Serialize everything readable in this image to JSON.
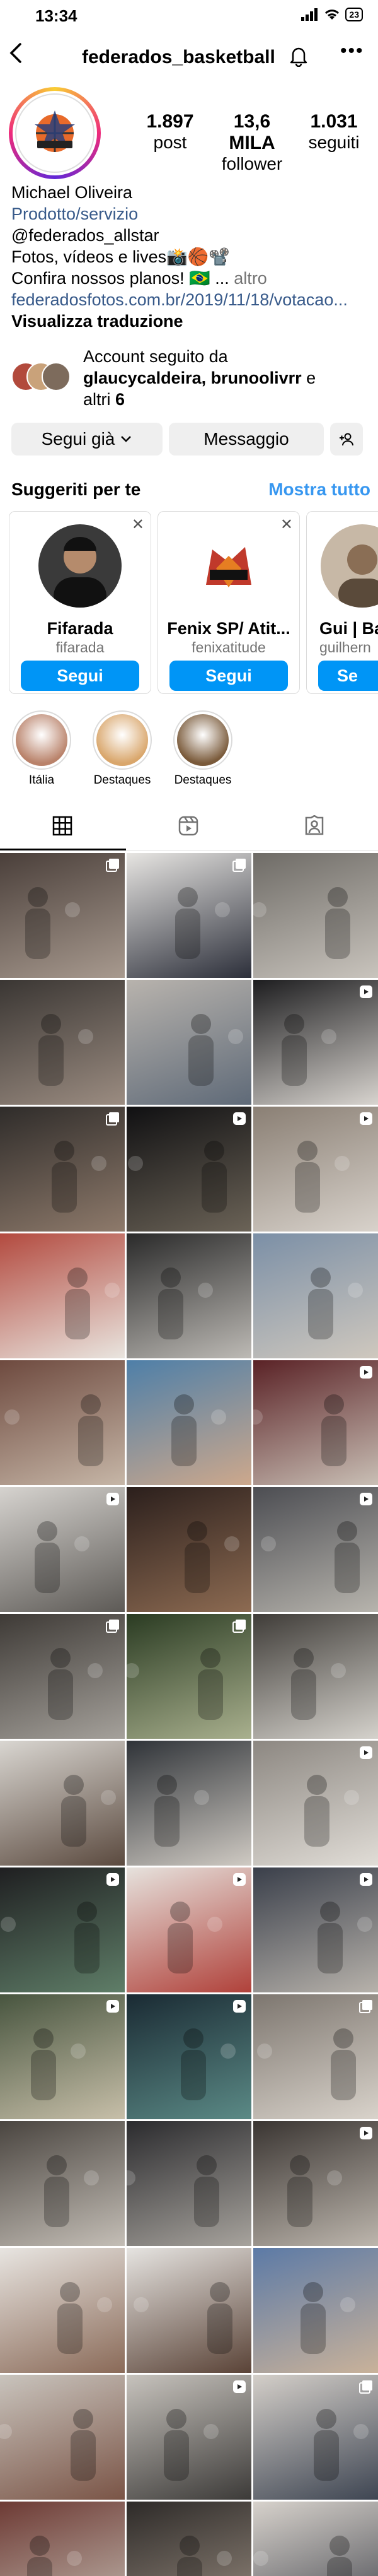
{
  "status_bar": {
    "time": "13:34",
    "battery": "23"
  },
  "header": {
    "username": "federados_basketball"
  },
  "profile": {
    "stats": [
      {
        "value": "1.897",
        "label": "post"
      },
      {
        "value": "13,6 MILA",
        "label": "follower"
      },
      {
        "value": "1.031",
        "label": "seguiti"
      }
    ],
    "bio": {
      "name": "Michael Oliveira",
      "category": "Prodotto/servizio",
      "handle_line": "@federados_allstar",
      "line1": "Fotos, vídeos e lives📸🏀📽️",
      "line2_text": "Confira nossos planos! 🇧🇷 ...",
      "line2_more": "altro",
      "link": "federadosfotos.com.br/2019/11/18/votacao...",
      "translate": "Visualizza traduzione"
    },
    "followed_by": {
      "prefix": "Account seguito da",
      "names": "glaucycaldeira, brunoolivrr",
      "suffix_and": "e",
      "suffix_others": "altri",
      "count": "6"
    },
    "actions": {
      "following": "Segui già",
      "message": "Messaggio"
    }
  },
  "suggestions": {
    "title": "Suggeriti per te",
    "see_all": "Mostra tutto",
    "cards": [
      {
        "name": "Fifarada",
        "handle": "fifarada",
        "follow": "Segui",
        "avatar_color": "#222222"
      },
      {
        "name": "Fenix SP/ Atit...",
        "handle": "fenixatitude",
        "follow": "Segui",
        "avatar_color": "#c0392b"
      },
      {
        "name": "Gui | Ba",
        "handle": "guilhern",
        "follow": "Se",
        "avatar_color": "#8a6e55"
      }
    ]
  },
  "highlights": [
    {
      "label": "Itália",
      "color": "#b9826a"
    },
    {
      "label": "Destaques",
      "color": "#d9a66b"
    },
    {
      "label": "Destaques",
      "color": "#7a5a3a"
    }
  ],
  "grid": {
    "tiles": [
      {
        "c1": "#4a3f3a",
        "c2": "#a89a8f",
        "badge": "multi"
      },
      {
        "c1": "#e7e5e2",
        "c2": "#2c2f3a",
        "badge": "multi"
      },
      {
        "c1": "#6e6b66",
        "c2": "#c9c4bd",
        "badge": "none"
      },
      {
        "c1": "#3a3633",
        "c2": "#9b8c81",
        "badge": "none"
      },
      {
        "c1": "#b8b3ad",
        "c2": "#5f6a78",
        "badge": "none"
      },
      {
        "c1": "#1d1d1f",
        "c2": "#d8d4cf",
        "badge": "reel"
      },
      {
        "c1": "#2f2c2a",
        "c2": "#8e7a6b",
        "badge": "multi"
      },
      {
        "c1": "#101012",
        "c2": "#6b6357",
        "badge": "reel"
      },
      {
        "c1": "#8a7f74",
        "c2": "#d8d2cb",
        "badge": "reel"
      },
      {
        "c1": "#b34a3f",
        "c2": "#e9e5df",
        "badge": "none"
      },
      {
        "c1": "#2a2a2a",
        "c2": "#bdbab5",
        "badge": "none"
      },
      {
        "c1": "#7b8fa6",
        "c2": "#cfc8be",
        "badge": "none"
      },
      {
        "c1": "#6e4a3f",
        "c2": "#c6b6a7",
        "badge": "none"
      },
      {
        "c1": "#4e7fa8",
        "c2": "#cda88c",
        "badge": "none"
      },
      {
        "c1": "#5a2226",
        "c2": "#c9bfb5",
        "badge": "reel"
      },
      {
        "c1": "#d6d3cf",
        "c2": "#5d5a56",
        "badge": "reel"
      },
      {
        "c1": "#2b1f1c",
        "c2": "#8d6b52",
        "badge": "none"
      },
      {
        "c1": "#4c4d52",
        "c2": "#b7b4ad",
        "badge": "reel"
      },
      {
        "c1": "#3e3a36",
        "c2": "#a5a19b",
        "badge": "multi"
      },
      {
        "c1": "#2a3b22",
        "c2": "#a9b08e",
        "badge": "multi"
      },
      {
        "c1": "#3f3c38",
        "c2": "#d5d2cc",
        "badge": "none"
      },
      {
        "c1": "#d9d6d1",
        "c2": "#5b4a3f",
        "badge": "none"
      },
      {
        "c1": "#2f3338",
        "c2": "#cfcac3",
        "badge": "none"
      },
      {
        "c1": "#8c8781",
        "c2": "#e1ddd7",
        "badge": "reel"
      },
      {
        "c1": "#1f1f21",
        "c2": "#5f7e68",
        "badge": "reel"
      },
      {
        "c1": "#e6e2dd",
        "c2": "#b0413a",
        "badge": "reel"
      },
      {
        "c1": "#3a3f4a",
        "c2": "#b7b2ab",
        "badge": "reel"
      },
      {
        "c1": "#48553f",
        "c2": "#c7bfa9",
        "badge": "reel"
      },
      {
        "c1": "#1a2a33",
        "c2": "#5b8a86",
        "badge": "reel"
      },
      {
        "c1": "#7d766f",
        "c2": "#d9d3cb",
        "badge": "multi"
      },
      {
        "c1": "#4a4540",
        "c2": "#c4beb6",
        "badge": "none"
      },
      {
        "c1": "#2b2b2e",
        "c2": "#a7a39d",
        "badge": "none"
      },
      {
        "c1": "#3a3532",
        "c2": "#bdb6ad",
        "badge": "reel"
      },
      {
        "c1": "#e8e5e1",
        "c2": "#8a6a58",
        "badge": "none"
      },
      {
        "c1": "#e6e4e1",
        "c2": "#5a4337",
        "badge": "none"
      },
      {
        "c1": "#5c7aa6",
        "c2": "#c9b29a",
        "badge": "none"
      },
      {
        "c1": "#c9c4bd",
        "c2": "#7a5446",
        "badge": "none"
      },
      {
        "c1": "#c7c3bd",
        "c2": "#3c3a38",
        "badge": "reel"
      },
      {
        "c1": "#d4cfc9",
        "c2": "#3e4552",
        "badge": "multi"
      },
      {
        "c1": "#6d3a34",
        "c2": "#c5bdb3",
        "badge": "none"
      },
      {
        "c1": "#2d2a28",
        "c2": "#9b8e82",
        "badge": "none"
      },
      {
        "c1": "#d7d2cc",
        "c2": "#43454d",
        "badge": "none"
      }
    ]
  }
}
